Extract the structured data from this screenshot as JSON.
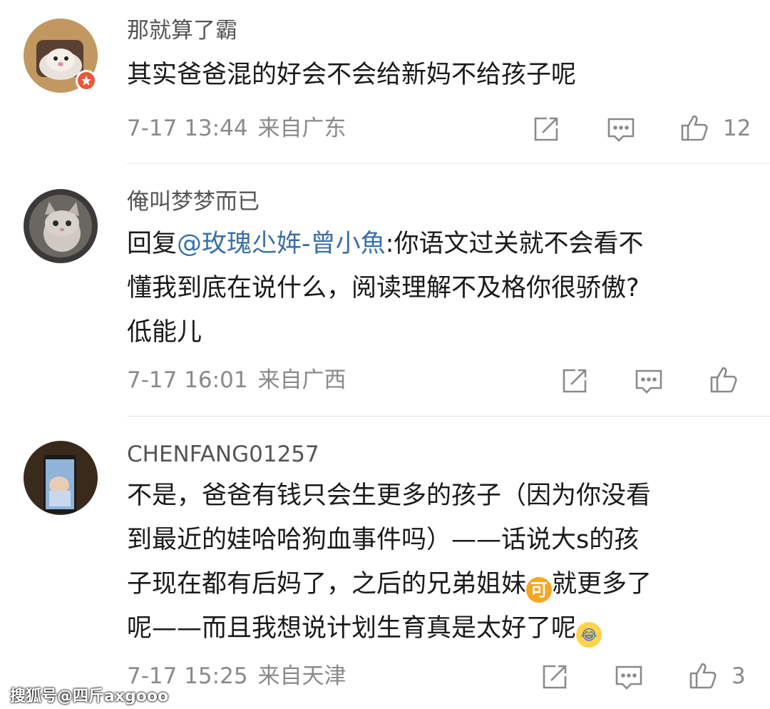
{
  "comments": [
    {
      "username": "那就算了霸",
      "lines": [
        "其实爸爸混的好会不会给新妈不给孩子呢"
      ],
      "time": "7-17 13:44",
      "location": "来自广东",
      "like_count": "12"
    },
    {
      "username": "俺叫梦梦而已",
      "reply_prefix": "回复",
      "mention": "@玫瑰尐姩-曾小魚",
      "line1_rest": ":你语文过关就不会看不",
      "lines": [
        "懂我到底在说什么，阅读理解不及格你很骄傲?",
        "低能儿"
      ],
      "time": "7-17 16:01",
      "location": "来自广西",
      "like_count": ""
    },
    {
      "username": "CHENFANG01257",
      "lines": [
        "不是，爸爸有钱只会生更多的孩子（因为你没看",
        "到最近的娃哈哈狗血事件吗）——话说大s的孩"
      ],
      "line3_a": "子现在都有后妈了，之后的兄弟姐妹",
      "emoji_ke": "可",
      "line3_b": "就更多了",
      "line4": "呢——而且我想说计划生育真是太好了呢",
      "time": "7-17 15:25",
      "location": "来自天津",
      "like_count": "3"
    }
  ],
  "watermark": "搜狐号@四斤axgooo",
  "icons": {
    "repost": "repost-icon",
    "comment": "comment-icon",
    "like": "like-icon"
  },
  "colors": {
    "mention": "#3b6fa8",
    "meta": "#8a8a8a",
    "badge": "#e8583a"
  }
}
